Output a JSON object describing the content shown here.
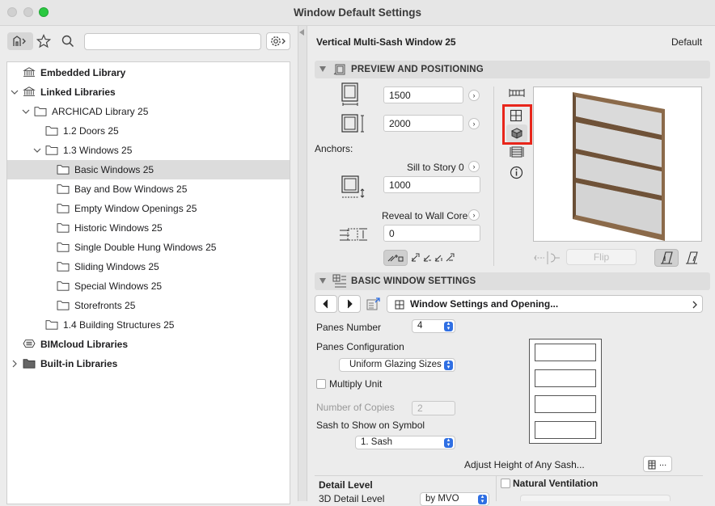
{
  "window": {
    "title": "Window Default Settings"
  },
  "left": {
    "search": {
      "value": "",
      "placeholder": ""
    },
    "tree": [
      {
        "label": "Embedded Library",
        "bold": true,
        "indent": 0,
        "chevron": "none",
        "icon": "library"
      },
      {
        "label": "Linked Libraries",
        "bold": true,
        "indent": 0,
        "chevron": "down",
        "icon": "library"
      },
      {
        "label": "ARCHICAD Library 25",
        "bold": false,
        "indent": 1,
        "chevron": "down",
        "icon": "folder"
      },
      {
        "label": "1.2 Doors 25",
        "bold": false,
        "indent": 2,
        "chevron": "none",
        "icon": "folder"
      },
      {
        "label": "1.3 Windows 25",
        "bold": false,
        "indent": 2,
        "chevron": "down",
        "icon": "folder"
      },
      {
        "label": "Basic Windows 25",
        "bold": false,
        "indent": 3,
        "chevron": "none",
        "icon": "folder",
        "selected": true
      },
      {
        "label": "Bay and Bow Windows 25",
        "bold": false,
        "indent": 3,
        "chevron": "none",
        "icon": "folder"
      },
      {
        "label": "Empty Window Openings 25",
        "bold": false,
        "indent": 3,
        "chevron": "none",
        "icon": "folder"
      },
      {
        "label": "Historic Windows 25",
        "bold": false,
        "indent": 3,
        "chevron": "none",
        "icon": "folder"
      },
      {
        "label": "Single Double Hung Windows 25",
        "bold": false,
        "indent": 3,
        "chevron": "none",
        "icon": "folder"
      },
      {
        "label": "Sliding Windows 25",
        "bold": false,
        "indent": 3,
        "chevron": "none",
        "icon": "folder"
      },
      {
        "label": "Special Windows 25",
        "bold": false,
        "indent": 3,
        "chevron": "none",
        "icon": "folder"
      },
      {
        "label": "Storefronts 25",
        "bold": false,
        "indent": 3,
        "chevron": "none",
        "icon": "folder"
      },
      {
        "label": "1.4 Building Structures 25",
        "bold": false,
        "indent": 2,
        "chevron": "none",
        "icon": "folder"
      },
      {
        "label": "BIMcloud Libraries",
        "bold": true,
        "indent": 0,
        "chevron": "none",
        "icon": "bimcloud"
      },
      {
        "label": "Built-in Libraries",
        "bold": true,
        "indent": 0,
        "chevron": "right",
        "icon": "folder-dark"
      }
    ]
  },
  "right": {
    "object_name": "Vertical Multi-Sash Window 25",
    "default_label": "Default",
    "preview_section": {
      "title": "PREVIEW AND POSITIONING",
      "width_value": "1500",
      "height_value": "2000",
      "anchors_label": "Anchors:",
      "sill_label": "Sill to Story 0",
      "sill_value": "1000",
      "reveal_label": "Reveal to Wall Core",
      "reveal_value": "0",
      "flip_label": "Flip"
    },
    "basic_section": {
      "title": "BASIC WINDOW SETTINGS",
      "page_selector": "Window Settings and Opening...",
      "panes_number_label": "Panes Number",
      "panes_number_value": "4",
      "panes_config_label": "Panes Configuration",
      "panes_config_value": "Uniform Glazing Sizes",
      "multiply_unit_label": "Multiply Unit",
      "copies_label": "Number of Copies",
      "copies_value": "2",
      "sash_symbol_label": "Sash to Show on Symbol",
      "sash_symbol_value": "1. Sash",
      "adjust_label": "Adjust Height of Any Sash...",
      "adjust_button": "..."
    },
    "bottom": {
      "detail_level_label": "Detail Level",
      "detail_3d_label": "3D Detail Level",
      "detail_3d_value": "by MVO",
      "natural_vent_label": "Natural Ventilation"
    }
  },
  "colors": {
    "highlight": "#e8261b",
    "selected_row": "#dcdcdc",
    "accent": "#2f6fe3",
    "wood": "#8b6a4a"
  }
}
